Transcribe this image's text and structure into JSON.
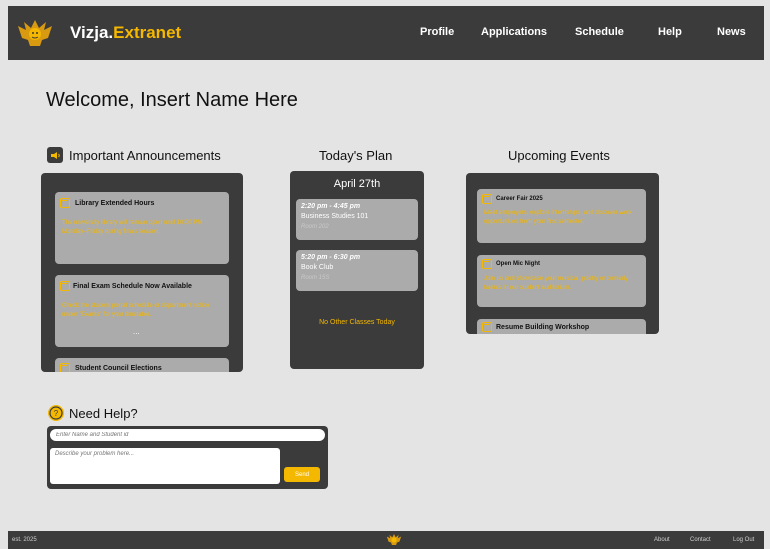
{
  "header": {
    "brand_prefix": "Vizja.",
    "brand_accent": "Extranet",
    "logo_icon": "lion-crest-icon",
    "nav": [
      "Profile",
      "Applications",
      "Schedule",
      "Help",
      "News"
    ]
  },
  "welcome": "Welcome, Insert Name Here",
  "announcements": {
    "title": "Important Announcements",
    "icon": "megaphone-icon",
    "items": [
      {
        "title": "Library Extended Hours",
        "body": "The university library will remain open until 10:00 PM Monday–Friday during finals season."
      },
      {
        "title": "Final Exam Schedule Now Available",
        "body": "Check the student portal schedule or department notice under \"Exams\" for your timetable."
      },
      {
        "title": "Student Council Elections",
        "body": ""
      }
    ],
    "ellipsis": "..."
  },
  "plan": {
    "title": "Today's Plan",
    "date": "April 27th",
    "slots": [
      {
        "time": "2:20 pm - 4:45 pm",
        "name": "Business Studies 101",
        "room": "Room 202"
      },
      {
        "time": "5:20 pm - 6:30 pm",
        "name": "Book Club",
        "room": "Room 15S"
      }
    ],
    "empty_note": "No Other Classes Today"
  },
  "events": {
    "title": "Upcoming Events",
    "items": [
      {
        "title": "Career Fair 2025",
        "body": "Meet employers, explore internships, and discover work opportunities from your first semester."
      },
      {
        "title": "Open Mic Night",
        "body": "Join us and showcase your musical, poetry or comedy talents in our student auditorium."
      },
      {
        "title": "Resume Building Workshop",
        "body": ""
      }
    ]
  },
  "help": {
    "title": "Need Help?",
    "icon": "question-circle-icon",
    "name_placeholder": "Enter Name and Student id",
    "problem_placeholder": "Describe your problem here...",
    "send_label": "Send"
  },
  "footer": {
    "est": "est. 2025",
    "links": [
      "About",
      "Contact",
      "Log Out"
    ]
  },
  "colors": {
    "dark": "#3b3b3b",
    "accent": "#f5b800",
    "card": "#ababab",
    "background": "#e4e4e4"
  }
}
